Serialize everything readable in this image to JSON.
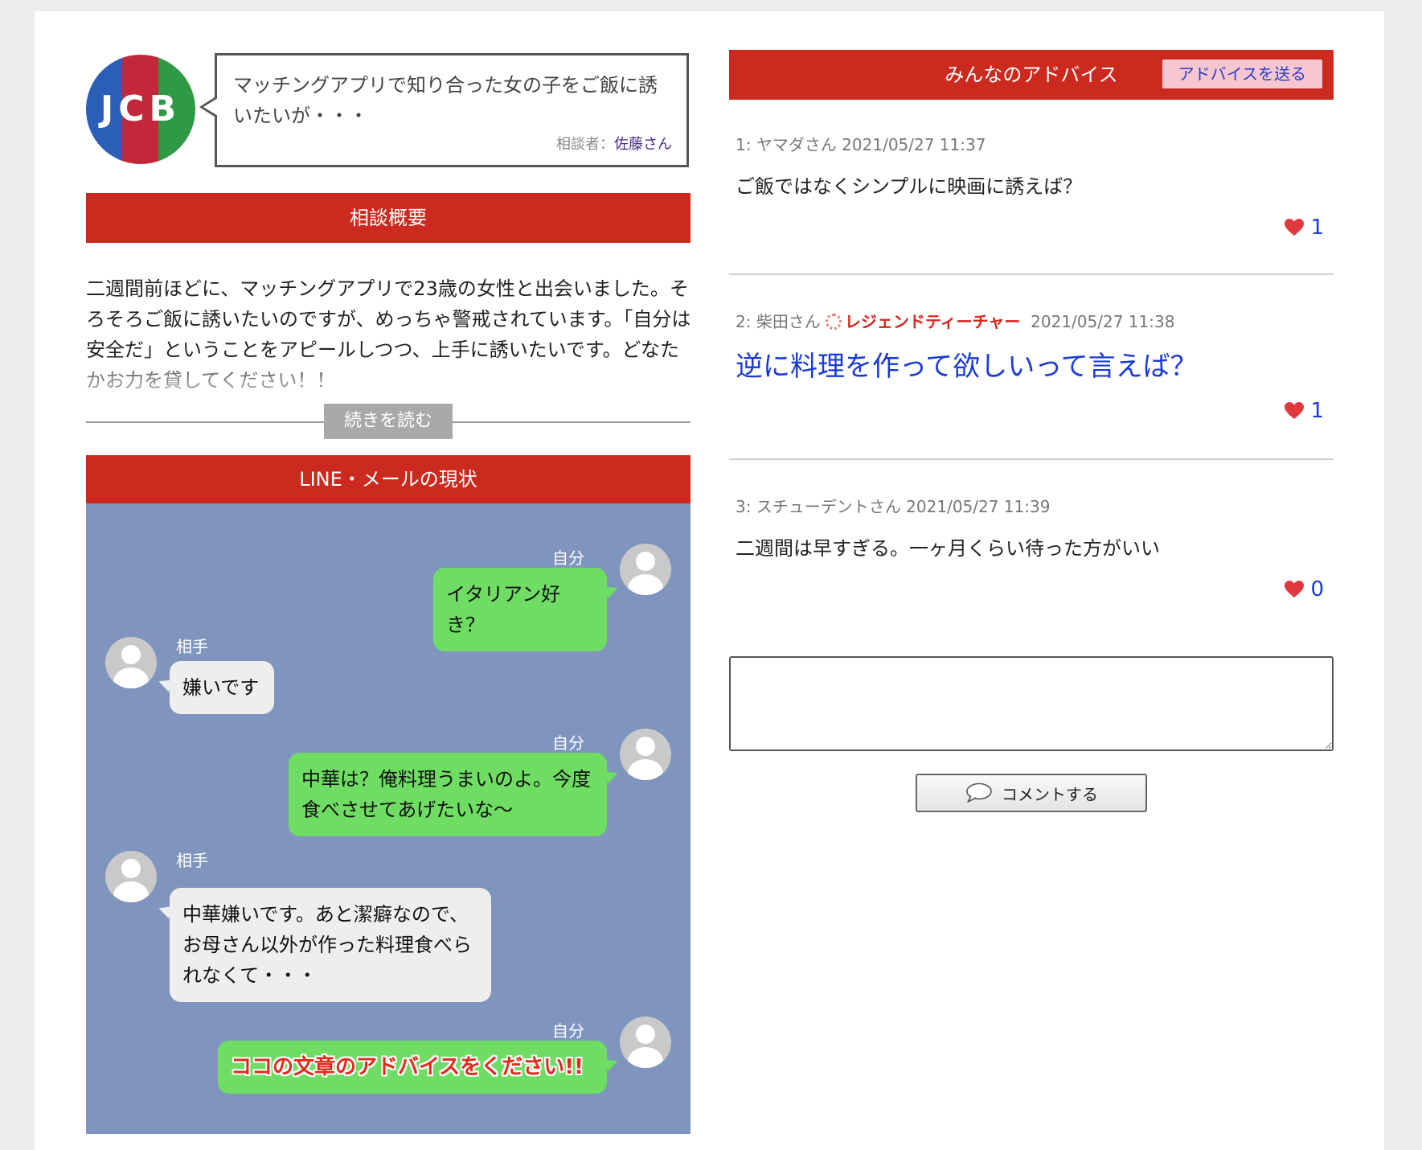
{
  "question": {
    "text": "マッチングアプリで知り合った女の子をご飯に誘いたいが・・・",
    "asker_label": "相談者：",
    "asker_name": "佐藤さん",
    "logo_text": "JCB"
  },
  "summary": {
    "heading": "相談概要",
    "body": "二週間前ほどに、マッチングアプリで23歳の女性と出会いました。そろそろご飯に誘いたいのですが、めっちゃ警戒されています。「自分は安全だ」ということをアピールしつつ、上手に誘いたいです。どなたかお力を貸してください！！",
    "read_more": "続きを読む"
  },
  "chat": {
    "heading": "LINE・メールの現状",
    "messages": [
      {
        "speaker": "自分",
        "text": "イタリアン好き？"
      },
      {
        "speaker": "相手",
        "text": "嫌いです"
      },
      {
        "speaker": "自分",
        "text": "中華は？俺料理うまいのよ。今度食べさせてあげたいな〜"
      },
      {
        "speaker": "相手",
        "text": "中華嫌いです。あと潔癖なので、お母さん以外が作った料理食べられなくて・・・"
      },
      {
        "speaker": "自分",
        "text": "ココの文章のアドバイスをください!!"
      }
    ]
  },
  "advice": {
    "heading": "みんなのアドバイス",
    "send_label": "アドバイスを送る",
    "items": [
      {
        "meta": "1: ヤマダさん 2021/05/27 11:37",
        "text": "ご飯ではなくシンプルに映画に誘えば？",
        "likes": "1"
      },
      {
        "meta_prefix": "2: 柴田さん",
        "badge": "レジェンドティーチャー",
        "meta_suffix": "2021/05/27 11:38",
        "text": "逆に料理を作って欲しいって言えば？",
        "likes": "1"
      },
      {
        "meta": "3: スチューデントさん 2021/05/27 11:39",
        "text": "二週間は早すぎる。一ヶ月くらい待った方がいい",
        "likes": "0"
      }
    ]
  },
  "comment": {
    "placeholder": "",
    "button_label": "コメントする"
  },
  "colors": {
    "accent_red": "#cc2a1f",
    "chat_bg": "#7f95bd",
    "bubble_green": "#6fdd63",
    "link_blue": "#1a3bd8"
  }
}
